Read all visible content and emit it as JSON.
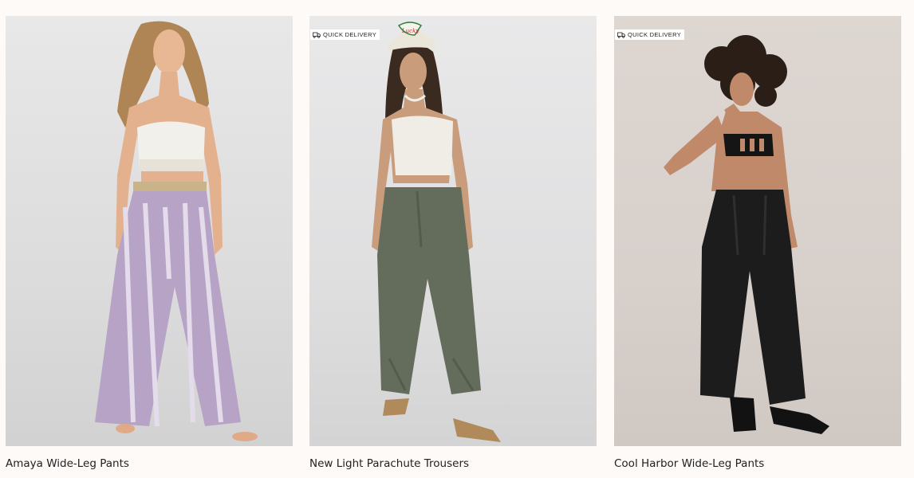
{
  "products": [
    {
      "title": "Amaya Wide-Leg Pants",
      "badge": "",
      "image_icon": "model-photo-icon",
      "colors": {
        "pants": "#b6a3c6",
        "top": "#f2f0ea",
        "hair": "#b08555"
      }
    },
    {
      "title": "New Light Parachute Trousers",
      "badge": "QUICK DELIVERY",
      "badge_icon": "delivery-truck-icon",
      "cap_text": "Lucky",
      "image_icon": "model-photo-icon",
      "colors": {
        "pants": "#646c5c",
        "top": "#efede5",
        "hair": "#3b2a20"
      }
    },
    {
      "title": "Cool Harbor Wide-Leg Pants",
      "badge": "QUICK DELIVERY",
      "badge_icon": "delivery-truck-icon",
      "image_icon": "model-photo-icon",
      "colors": {
        "pants": "#1c1c1c",
        "top": "#151515",
        "hair": "#2a1e17"
      }
    }
  ]
}
